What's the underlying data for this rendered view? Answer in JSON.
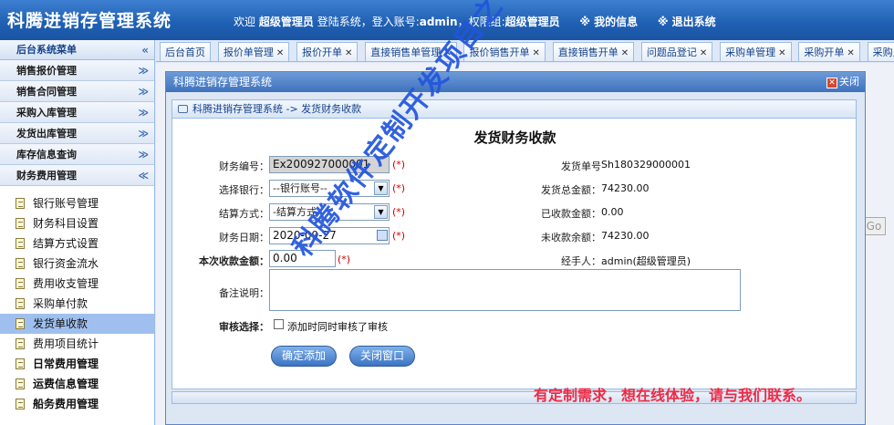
{
  "header": {
    "title": "科腾进销存管理系统",
    "welcome": "欢迎",
    "user_role": "超级管理员",
    "login_text": "登陆系统，登入账号:",
    "account": "admin",
    "perm_text": "，权限组:",
    "perm_group": "超级管理员",
    "my_info": "※ 我的信息",
    "logout": "※ 退出系统"
  },
  "sidebar": {
    "title": "后台系统菜单",
    "categories": [
      {
        "label": "销售报价管理"
      },
      {
        "label": "销售合同管理"
      },
      {
        "label": "采购入库管理"
      },
      {
        "label": "发货出库管理"
      },
      {
        "label": "库存信息查询"
      },
      {
        "label": "财务费用管理"
      }
    ],
    "items": [
      {
        "label": "银行账号管理"
      },
      {
        "label": "财务科目设置"
      },
      {
        "label": "结算方式设置"
      },
      {
        "label": "银行资金流水"
      },
      {
        "label": "费用收支管理"
      },
      {
        "label": "采购单付款"
      },
      {
        "label": "发货单收款"
      },
      {
        "label": "费用项目统计"
      },
      {
        "label": "日常费用管理"
      },
      {
        "label": "运费信息管理"
      },
      {
        "label": "船务费用管理"
      }
    ]
  },
  "tabs": [
    {
      "label": "后台首页"
    },
    {
      "label": "报价单管理"
    },
    {
      "label": "报价开单"
    },
    {
      "label": "直接销售单管理"
    },
    {
      "label": "报价销售开单"
    },
    {
      "label": "直接销售开单"
    },
    {
      "label": "问题品登记"
    },
    {
      "label": "采购单管理"
    },
    {
      "label": "采购开单"
    },
    {
      "label": "采购入库流水"
    }
  ],
  "background": {
    "go_button": "Go"
  },
  "modal": {
    "title": "科腾进销存管理系统",
    "close": "关闭",
    "breadcrumb": "科腾进销存管理系统 -> 发货财务收款",
    "form_title": "发货财务收款",
    "fields": {
      "finance_no_label": "财务编号：",
      "finance_no_value": "Ex200927000001",
      "bank_label": "选择银行：",
      "bank_value": "--银行账号--",
      "settle_label": "结算方式：",
      "settle_value": "-结算方式-",
      "date_label": "财务日期：",
      "date_value": "2020-09-27",
      "amount_label": "本次收款金额：",
      "amount_value": "0.00",
      "remark_label": "备注说明：",
      "audit_label": "审核选择：",
      "audit_text": "添加时同时审核了审核",
      "required_mark": "(*)",
      "ship_no_label": "发货单号",
      "ship_no_value": "Sh180329000001",
      "ship_total_label": "发货总金额：",
      "ship_total_value": "74230.00",
      "received_label": "已收款金额：",
      "received_value": "0.00",
      "unreceived_label": "未收款余额：",
      "unreceived_value": "74230.00",
      "handler_label": "经手人：",
      "handler_value": "admin(超级管理员)"
    },
    "buttons": {
      "confirm": "确定添加",
      "close_window": "关闭窗口"
    }
  },
  "watermark": "科腾软件定制开发项目之一",
  "promo": "有定制需求，想在线体验，请与我们联系。",
  "colors": {
    "header_blue": "#1f5fb3",
    "accent_red": "#cc0000",
    "promo_pink": "#ee2a46",
    "watermark_blue": "#2255dd",
    "active_item": "#9fc0ef"
  }
}
